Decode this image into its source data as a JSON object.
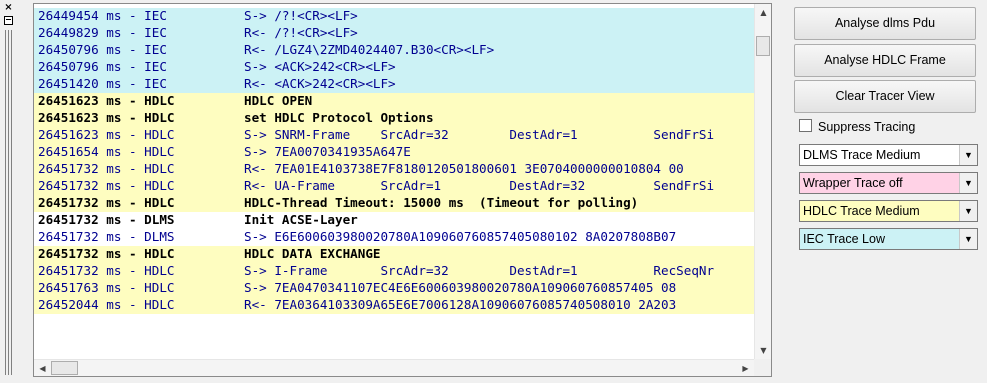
{
  "dock": {
    "close_glyph": "×"
  },
  "tracer": {
    "lines": [
      {
        "ts": "26449454 ms - IEC",
        "msg": "S-> /?!<CR><LF>",
        "cat": "iec"
      },
      {
        "ts": "26449829 ms - IEC",
        "msg": "R<- /?!<CR><LF>",
        "cat": "iec"
      },
      {
        "ts": "26450796 ms - IEC",
        "msg": "R<- /LGZ4\\2ZMD4024407.B30<CR><LF>",
        "cat": "iec"
      },
      {
        "ts": "26450796 ms - IEC",
        "msg": "S-> <ACK>242<CR><LF>",
        "cat": "iec"
      },
      {
        "ts": "26451420 ms - IEC",
        "msg": "R<- <ACK>242<CR><LF>",
        "cat": "iec"
      },
      {
        "ts": "26451623 ms - HDLC",
        "msg": "HDLC OPEN",
        "cat": "hdlc",
        "plain": true
      },
      {
        "ts": "26451623 ms - HDLC",
        "msg": "set HDLC Protocol Options",
        "cat": "hdlc",
        "plain": true
      },
      {
        "ts": "26451623 ms - HDLC",
        "msg": "S-> SNRM-Frame    SrcAdr=32        DestAdr=1          SendFrSi",
        "cat": "hdlc"
      },
      {
        "ts": "26451654 ms - HDLC",
        "msg": "S-> 7EA0070341935A647E",
        "cat": "hdlc"
      },
      {
        "ts": "26451732 ms - HDLC",
        "msg": "R<- 7EA01E4103738E7F8180120501800601 3E0704000000010804 00",
        "cat": "hdlc"
      },
      {
        "ts": "26451732 ms - HDLC",
        "msg": "R<- UA-Frame      SrcAdr=1         DestAdr=32         SendFrSi",
        "cat": "hdlc"
      },
      {
        "ts": "26451732 ms - HDLC",
        "msg": "HDLC-Thread Timeout: 15000 ms  (Timeout for polling)",
        "cat": "hdlc",
        "plain": true
      },
      {
        "ts": "26451732 ms - DLMS",
        "msg": "Init ACSE-Layer",
        "cat": "dlms",
        "plain": true
      },
      {
        "ts": "26451732 ms - DLMS",
        "msg": "S-> E6E600603980020780A109060760857405080102 8A0207808B07",
        "cat": "dlms"
      },
      {
        "ts": "26451732 ms - HDLC",
        "msg": "HDLC DATA EXCHANGE",
        "cat": "hdlc",
        "plain": true
      },
      {
        "ts": "26451732 ms - HDLC",
        "msg": "S-> I-Frame       SrcAdr=32        DestAdr=1          RecSeqNr",
        "cat": "hdlc"
      },
      {
        "ts": "26451763 ms - HDLC",
        "msg": "S-> 7EA0470341107EC4E6E600603980020780A109060760857405 08",
        "cat": "hdlc"
      },
      {
        "ts": "26452044 ms - HDLC",
        "msg": "R<- 7EA0364103309A65E6E7006128A10906076085740508010 2A203",
        "cat": "hdlc"
      }
    ]
  },
  "panel": {
    "analyse_dlms_label": "Analyse dlms Pdu",
    "analyse_hdlc_label": "Analyse HDLC Frame",
    "clear_label": "Clear Tracer View",
    "suppress_label": "Suppress Tracing",
    "dropdowns": [
      {
        "value": "DLMS Trace Medium",
        "color": "#ffffff"
      },
      {
        "value": "Wrapper Trace off",
        "color": "#ffd2e6"
      },
      {
        "value": "HDLC Trace Medium",
        "color": "#fefdc0"
      },
      {
        "value": "IEC Trace Low",
        "color": "#ccf2f5"
      }
    ]
  },
  "colors": {
    "iec_bg": "#ccf2f5",
    "hdlc_bg": "#fefdc0",
    "dlms_bg": "#ffffff",
    "trace_text": "#000090"
  }
}
